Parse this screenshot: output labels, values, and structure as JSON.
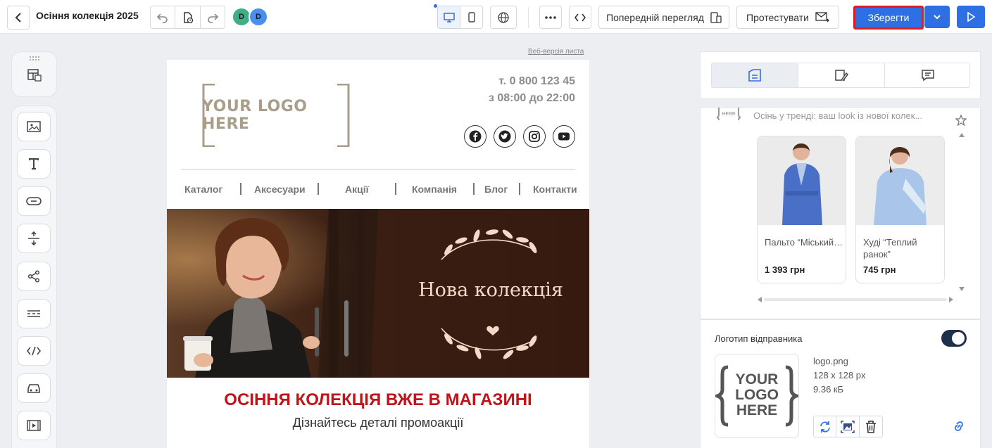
{
  "header": {
    "title": "Осіння колекція 2025",
    "avatars": [
      "D",
      "D"
    ],
    "preview_label": "Попередній перегляд",
    "test_label": "Протестувати",
    "save_label": "Зберегти",
    "colors": {
      "accent": "#2f6fe4",
      "highlight": "#e11b22"
    }
  },
  "email": {
    "web_version": "Веб-версія листа",
    "logo_text": "YOUR LOGO HERE",
    "phone": "т. 0 800 123 45",
    "hours": "з 08:00 до 22:00",
    "social": [
      "facebook-icon",
      "twitter-icon",
      "instagram-icon",
      "youtube-icon"
    ],
    "nav": [
      "Каталог",
      "Аксесуари",
      "Акції",
      "Компанія",
      "Блог",
      "Контакти"
    ],
    "hero_title": "Нова колекція",
    "headline": "ОСІННЯ КОЛЕКЦІЯ ВЖЕ В МАГАЗИНІ",
    "subheadline": "Дізнайтесь деталі промоакції",
    "headline_color": "#c0141b"
  },
  "right_panel": {
    "tabs": [
      "blocks-tab-icon",
      "style-tab-icon",
      "comments-tab-icon"
    ],
    "preview_subject": "Осінь у тренді: ваш look із нової колек...",
    "products": [
      {
        "name": "Пальто “Міський…",
        "price": "1 393 грн"
      },
      {
        "name": "Худі “Теплий ранок”",
        "price": "745 грн"
      }
    ],
    "sender_logo_label": "Логотип відправника",
    "sender_logo_enabled": true,
    "logo_file": {
      "name": "logo.png",
      "dimensions": "128 x 128 px",
      "size": "9.36 кБ"
    },
    "logo_preview_text": "YOUR LOGO HERE"
  }
}
